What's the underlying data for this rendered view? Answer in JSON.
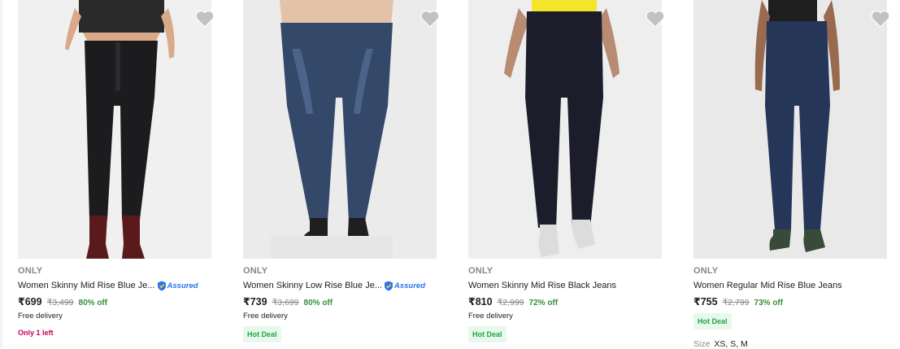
{
  "products": [
    {
      "brand": "ONLY",
      "title": "Women Skinny Mid Rise Blue Je...",
      "assured_label": "Assured",
      "price": "₹699",
      "mrp": "₹3,499",
      "discount": "80% off",
      "delivery": "Free delivery",
      "stock": "Only 1 left",
      "image_icon": "black-jeans-model-photo"
    },
    {
      "brand": "ONLY",
      "title": "Women Skinny Low Rise Blue Je...",
      "assured_label": "Assured",
      "price": "₹739",
      "mrp": "₹3,699",
      "discount": "80% off",
      "delivery": "Free delivery",
      "deal": "Hot Deal",
      "image_icon": "blue-jeans-model-photo"
    },
    {
      "brand": "ONLY",
      "title": "Women Skinny Mid Rise Black Jeans",
      "price": "₹810",
      "mrp": "₹2,999",
      "discount": "72% off",
      "delivery": "Free delivery",
      "deal": "Hot Deal",
      "image_icon": "navy-jeans-model-photo"
    },
    {
      "brand": "ONLY",
      "title": "Women Regular Mid Rise Blue Jeans",
      "price": "₹755",
      "mrp": "₹2,799",
      "discount": "73% off",
      "deal": "Hot Deal",
      "size_label": "Size",
      "sizes": "XS, S, M",
      "image_icon": "dark-blue-jeans-model-photo"
    }
  ],
  "colors": {
    "discount_green": "#388e3c",
    "deal_bg": "#e7f8ec",
    "deal_text": "#26a541",
    "stock_pink": "#c70055",
    "assured_blue": "#2874f0",
    "muted_grey": "#878787"
  },
  "icons": {
    "wishlist": "heart-icon",
    "assured": "assured-shield-icon"
  }
}
